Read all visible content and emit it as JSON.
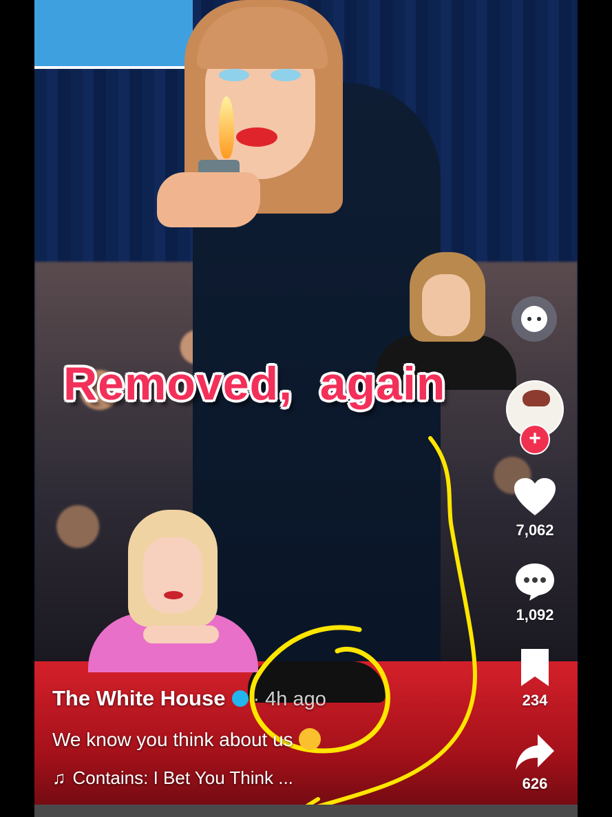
{
  "overlay": {
    "caption": "Removed,  again"
  },
  "post": {
    "username": "The White House",
    "time": "· 4h ago",
    "description": "We know you think about us",
    "music_note": "♫",
    "music": "Contains: I Bet You Think ..."
  },
  "rail": {
    "likes": "7,062",
    "comments": "1,092",
    "bookmarks": "234",
    "shares": "626",
    "follow": "+"
  },
  "icons": {
    "verified": "verified-badge-icon",
    "emoji": "face-with-hand-over-mouth-emoji",
    "heart": "heart-icon",
    "comment": "comment-bubble-icon",
    "bookmark": "bookmark-icon",
    "share": "share-arrow-icon"
  },
  "colors": {
    "overlay_text": "#f2305a",
    "follow_button": "#f0304f",
    "scribble": "#ffe600",
    "verified": "#23b5ee"
  }
}
